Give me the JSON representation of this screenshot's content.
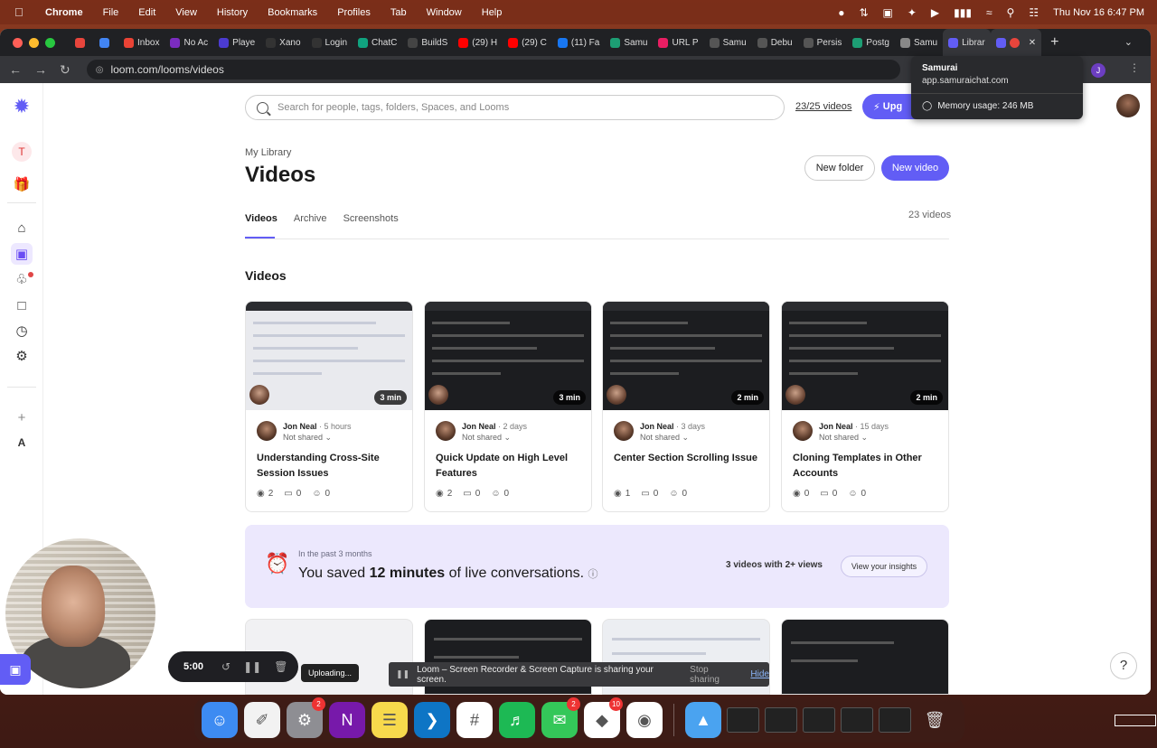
{
  "menubar": {
    "app": "Chrome",
    "items": [
      "File",
      "Edit",
      "View",
      "History",
      "Bookmarks",
      "Profiles",
      "Tab",
      "Window",
      "Help"
    ],
    "clock": "Thu Nov 16  6:47 PM"
  },
  "tabs": [
    {
      "label": "",
      "color": "#e8453c"
    },
    {
      "label": "",
      "color": "#4285f4"
    },
    {
      "label": "Inbox",
      "color": "#ea4335"
    },
    {
      "label": "No Ac",
      "color": "#7b2cbf"
    },
    {
      "label": "Playe",
      "color": "#4b3bd1"
    },
    {
      "label": "Xano",
      "color": "#333333"
    },
    {
      "label": "Login",
      "color": "#333333"
    },
    {
      "label": "ChatC",
      "color": "#10a37f"
    },
    {
      "label": "BuildS",
      "color": "#444444"
    },
    {
      "label": "(29) H",
      "color": "#ff0000"
    },
    {
      "label": "(29) C",
      "color": "#ff0000"
    },
    {
      "label": "(11) Fa",
      "color": "#1877f2"
    },
    {
      "label": "Samu",
      "color": "#1d9e74"
    },
    {
      "label": "URL P",
      "color": "#e91e63"
    },
    {
      "label": "Samu",
      "color": "#555555"
    },
    {
      "label": "Debu",
      "color": "#555555"
    },
    {
      "label": "Persis",
      "color": "#555555"
    },
    {
      "label": "Postg",
      "color": "#1d9e74"
    },
    {
      "label": "Samu",
      "color": "#888888"
    },
    {
      "label": "Librar",
      "color": "#625df5"
    }
  ],
  "url": "loom.com/looms/videos",
  "tooltip": {
    "title": "Samurai",
    "url": "app.samuraichat.com",
    "memory": "Memory usage: 246 MB"
  },
  "extensions": {
    "avatar": "J"
  },
  "sidebar": {
    "workspace_initial": "T",
    "bottom_initial": "A"
  },
  "search": {
    "placeholder": "Search for people, tags, folders, Spaces, and Looms"
  },
  "video_quota": "23/25 videos",
  "upgrade_label": "Upg",
  "breadcrumb": "My Library",
  "page_title": "Videos",
  "new_folder": "New folder",
  "new_video": "New video",
  "lib_tabs": [
    "Videos",
    "Archive",
    "Screenshots"
  ],
  "video_count": "23 videos",
  "section_title": "Videos",
  "cards": [
    {
      "author": "Jon Neal",
      "ago": "5 hours",
      "shared": "Not shared",
      "title": "Understanding Cross-Site Session Issues",
      "duration": "3 min",
      "views": "2",
      "comments": "0",
      "reactions": "0",
      "theme": "light"
    },
    {
      "author": "Jon Neal",
      "ago": "2 days",
      "shared": "Not shared",
      "title": "Quick Update on High Level Features",
      "duration": "3 min",
      "views": "2",
      "comments": "0",
      "reactions": "0",
      "theme": "dark"
    },
    {
      "author": "Jon Neal",
      "ago": "3 days",
      "shared": "Not shared",
      "title": "Center Section Scrolling Issue",
      "duration": "2 min",
      "views": "1",
      "comments": "0",
      "reactions": "0",
      "theme": "dark"
    },
    {
      "author": "Jon Neal",
      "ago": "15 days",
      "shared": "Not shared",
      "title": "Cloning Templates in Other Accounts",
      "duration": "2 min",
      "views": "0",
      "comments": "0",
      "reactions": "0",
      "theme": "dark"
    }
  ],
  "insights": {
    "period": "In the past 3 months",
    "saved_prefix": "You saved ",
    "saved_amount": "12 minutes",
    "saved_suffix": " of live conversations.",
    "views_note": "3 videos with 2+ views",
    "button": "View your insights"
  },
  "recorder": {
    "time": "5:00",
    "uploading": "Uploading..."
  },
  "sharebar": {
    "message": "Loom – Screen Recorder & Screen Capture is sharing your screen.",
    "stop": "Stop sharing",
    "hide": "Hide"
  },
  "help": "?",
  "dock": [
    {
      "name": "finder",
      "color": "#3d8bf2",
      "badge": ""
    },
    {
      "name": "freeform",
      "color": "#f2f2f2",
      "badge": ""
    },
    {
      "name": "system-settings",
      "color": "#8e8e93",
      "badge": "2"
    },
    {
      "name": "onenote",
      "color": "#7719aa",
      "badge": ""
    },
    {
      "name": "notes",
      "color": "#f7d94c",
      "badge": ""
    },
    {
      "name": "vscode",
      "color": "#0e75c5",
      "badge": ""
    },
    {
      "name": "slack",
      "color": "#ffffff",
      "badge": ""
    },
    {
      "name": "spotify",
      "color": "#1db954",
      "badge": ""
    },
    {
      "name": "messages",
      "color": "#34c759",
      "badge": "2"
    },
    {
      "name": "craft",
      "color": "#ffffff",
      "badge": "10"
    },
    {
      "name": "chrome",
      "color": "#ffffff",
      "badge": ""
    }
  ]
}
